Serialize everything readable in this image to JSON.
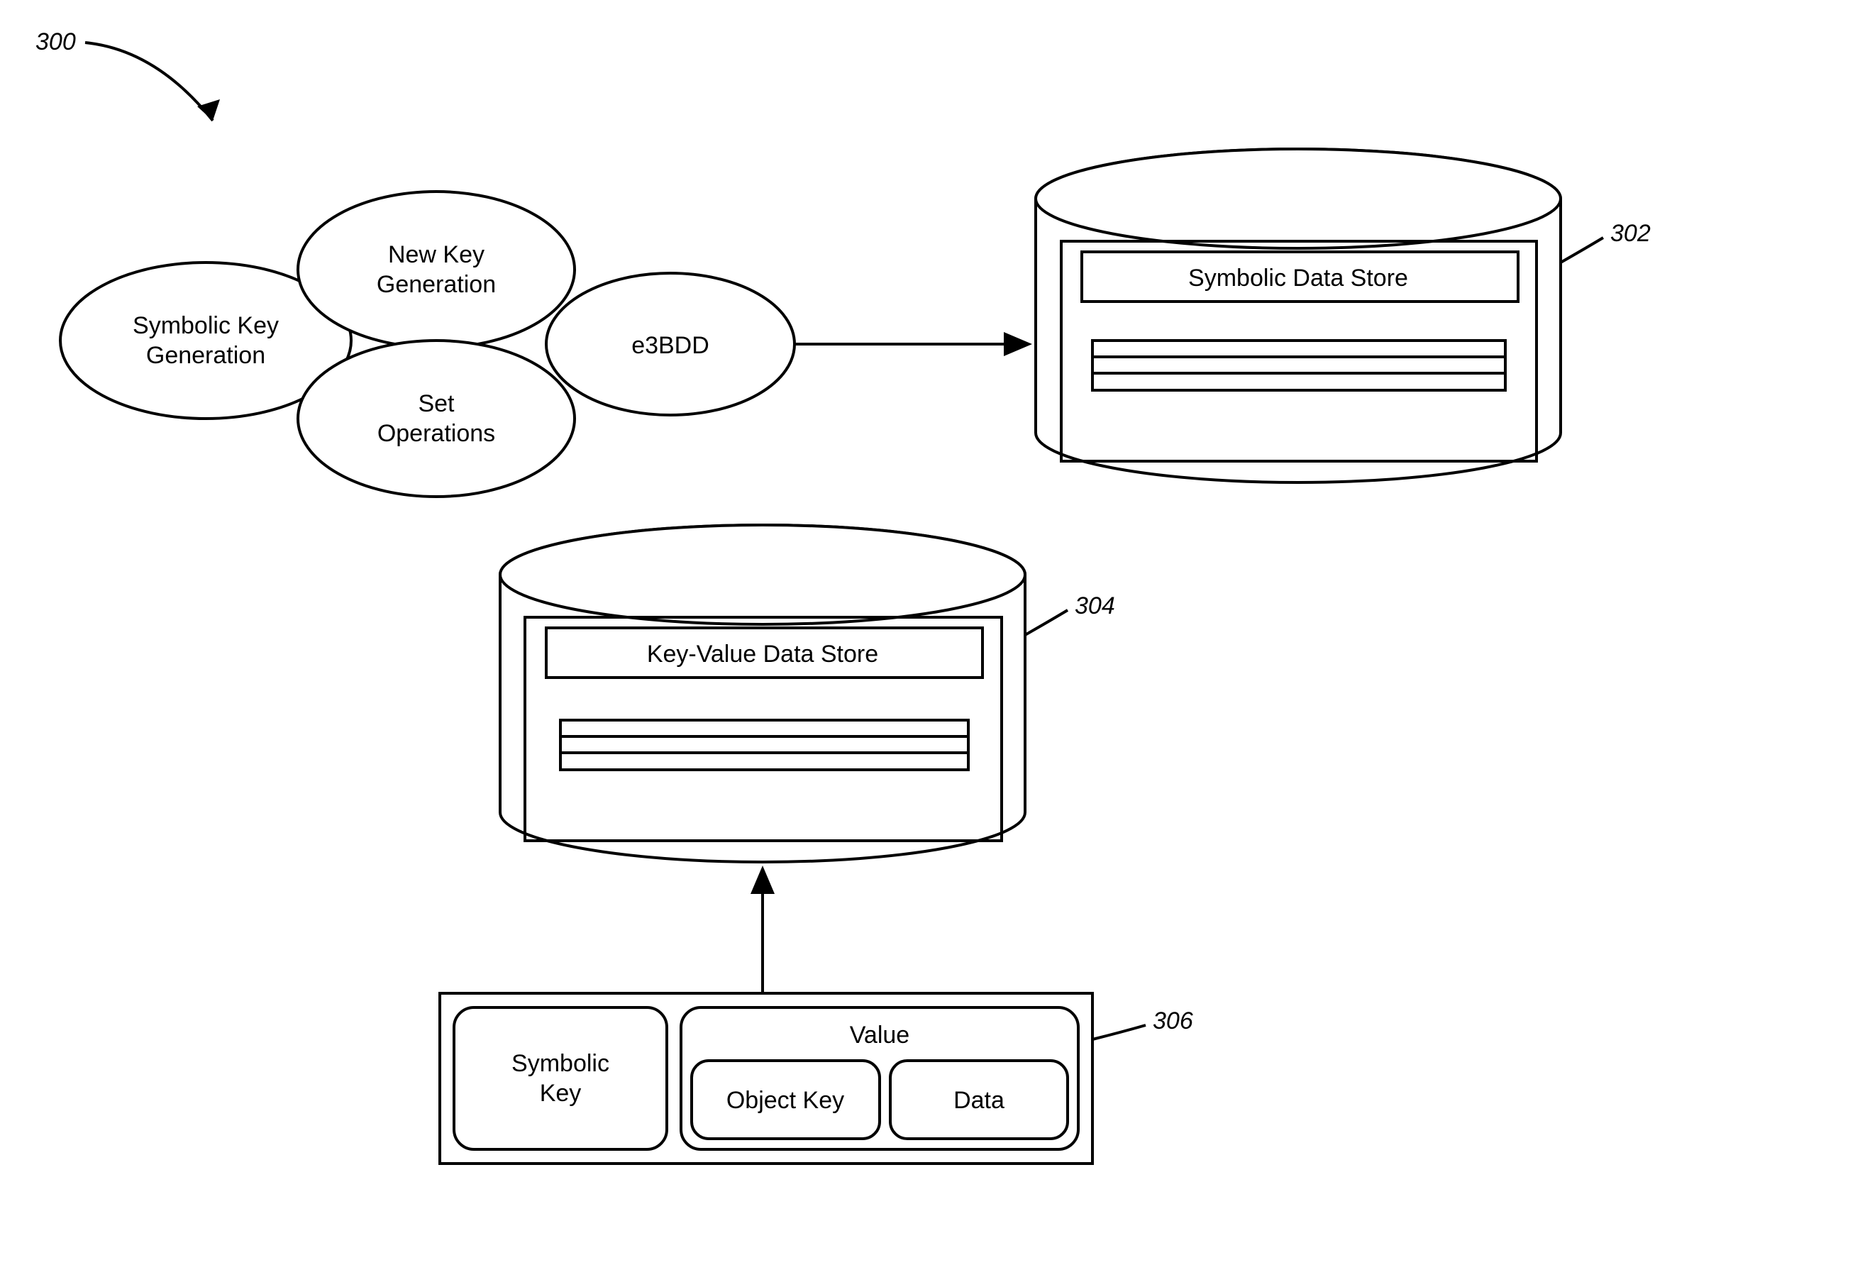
{
  "figure": {
    "ref300": "300",
    "ref302": "302",
    "ref304": "304",
    "ref306": "306"
  },
  "ellipses": {
    "symbolicKeyGen": {
      "line1": "Symbolic Key",
      "line2": "Generation"
    },
    "newKeyGen": {
      "line1": "New Key",
      "line2": "Generation"
    },
    "setOps": {
      "line1": "Set",
      "line2": "Operations"
    },
    "e3bdd": "e3BDD"
  },
  "db": {
    "symbolic": {
      "title": "Symbolic Data Store"
    },
    "kv": {
      "title": "Key-Value Data Store"
    }
  },
  "record": {
    "symKey": {
      "line1": "Symbolic",
      "line2": "Key"
    },
    "value": "Value",
    "objKey": "Object Key",
    "data": "Data"
  }
}
